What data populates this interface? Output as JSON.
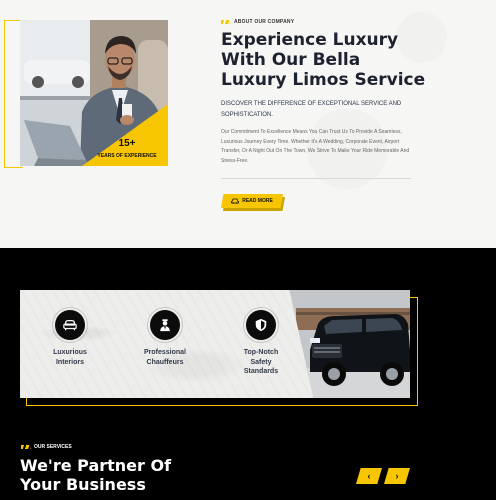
{
  "about": {
    "eyebrow": "ABOUT OUR COMPANY",
    "headline_line1": "Experience Luxury",
    "headline_line2": "With Our Bella",
    "headline_line3": "Luxury Limos Service",
    "subheading": "DISCOVER THE DIFFERENCE OF EXCEPTIONAL SERVICE AND SOPHISTICATION.",
    "body": "Our Commitment To Excellence Means You Can Trust Us To Provide A Seamless, Luxurious Journey Every Time. Whether It's A Wedding, Corporate Event, Airport Transfer, Or A Night Out On The Town, We Strive To Make Your Ride Memorable And Stress-Free.",
    "read_more": "READ MORE",
    "badge": {
      "number": "15+",
      "label": "YEARS OF EXPERIENCE"
    }
  },
  "features": [
    {
      "label_line1": "Luxurious",
      "label_line2": "Interiors",
      "label_line3": ""
    },
    {
      "label_line1": "Professional",
      "label_line2": "Chauffeurs",
      "label_line3": ""
    },
    {
      "label_line1": "Top-Notch",
      "label_line2": "Safety",
      "label_line3": "Standards"
    }
  ],
  "services": {
    "eyebrow": "OUR SERVICES",
    "title_line1": "We're Partner Of",
    "title_line2": "Your Business",
    "prev": "‹",
    "next": "›"
  },
  "colors": {
    "accent": "#f7c600",
    "dark": "#000000",
    "heading": "#1e2230"
  },
  "icons": [
    "sofa-icon",
    "chauffeur-icon",
    "shield-icon",
    "car-icon"
  ]
}
